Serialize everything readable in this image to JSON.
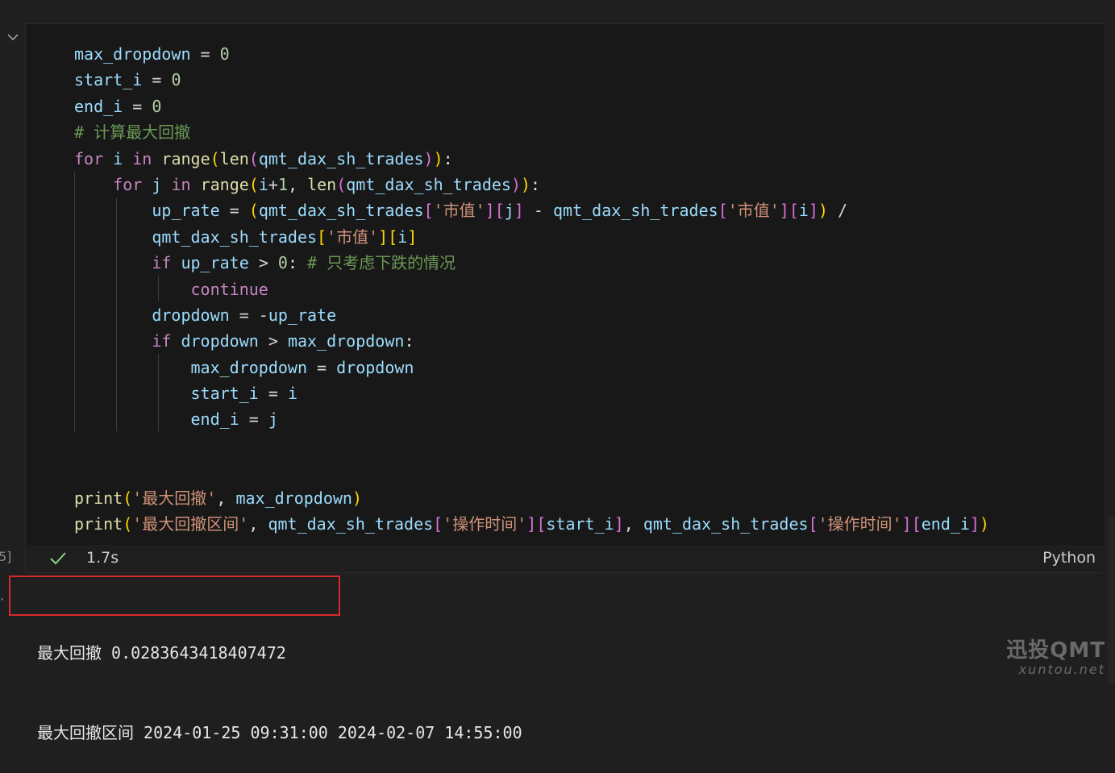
{
  "code_lines": [
    "max_dropdown = 0",
    "start_i = 0",
    "end_i = 0",
    "# 计算最大回撤",
    "for i in range(len(qmt_dax_sh_trades)):",
    "    for j in range(i+1, len(qmt_dax_sh_trades)):",
    "        up_rate = (qmt_dax_sh_trades['市值'][j] - qmt_dax_sh_trades['市值'][i]) /",
    "        qmt_dax_sh_trades['市值'][i]",
    "        if up_rate > 0: # 只考虑下跌的情况",
    "            continue",
    "        dropdown = -up_rate",
    "        if dropdown > max_dropdown:",
    "            max_dropdown = dropdown",
    "            start_i = i",
    "            end_i = j",
    "",
    "",
    "print('最大回撤', max_dropdown)",
    "print('最大回撤区间', qmt_dax_sh_trades['操作时间'][start_i], qmt_dax_sh_trades['操作时间'][end_i])"
  ],
  "status": {
    "execution_count": "5]",
    "duration": "1.7s",
    "language": "Python",
    "success_color": "#89d185"
  },
  "output_lines": [
    "最大回撤 0.0283643418407472",
    "最大回撤区间 2024-01-25 09:31:00 2024-02-07 14:55:00"
  ],
  "watermark": {
    "brand": "迅投QMT",
    "site": "xuntou.net"
  },
  "highlight_color": "#d9282a"
}
